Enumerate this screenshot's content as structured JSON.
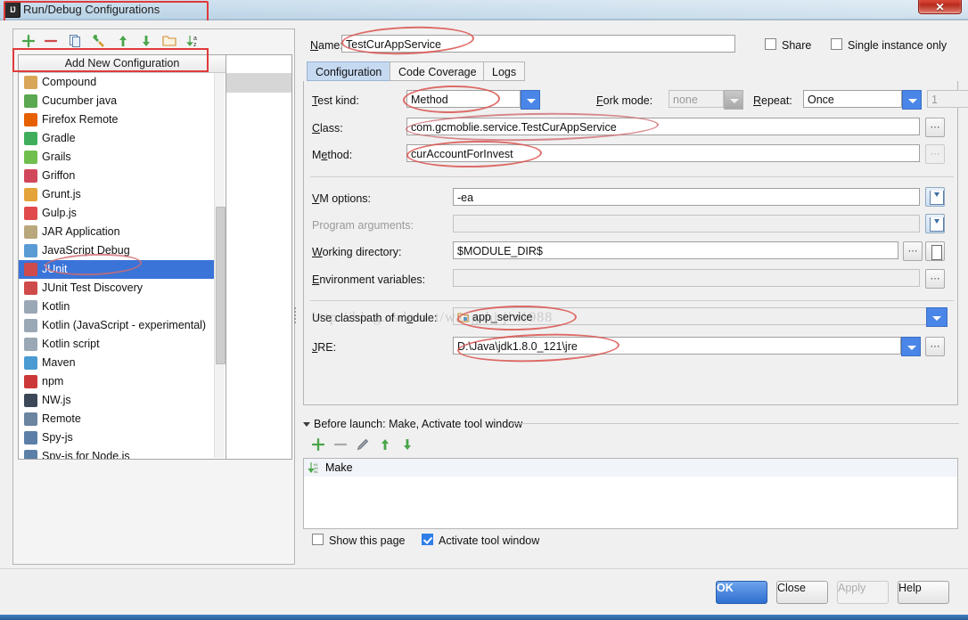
{
  "window": {
    "title": "Run/Debug Configurations",
    "app_icon": "IJ",
    "close_icon": "close-icon",
    "close_glyph": "✕"
  },
  "left_pane": {
    "toolbar": [
      {
        "name": "add-configuration-button",
        "icon": "plus-icon",
        "tooltip": "Add New Configuration"
      },
      {
        "name": "remove-configuration-button",
        "icon": "minus-icon",
        "tooltip": "Remove Configuration"
      },
      {
        "name": "copy-configuration-button",
        "icon": "copy-icon",
        "tooltip": "Copy Configuration"
      },
      {
        "name": "save-configuration-button",
        "icon": "wrench-icon",
        "tooltip": "Save Configuration"
      },
      {
        "name": "move-up-button",
        "icon": "arrow-up-icon",
        "tooltip": "Move Up"
      },
      {
        "name": "move-down-button",
        "icon": "arrow-down-icon",
        "tooltip": "Move Down"
      },
      {
        "name": "create-folder-button",
        "icon": "folder-icon",
        "tooltip": "Create New Folder"
      },
      {
        "name": "sort-configurations-button",
        "icon": "sort-az-icon",
        "tooltip": "Sort Configurations"
      }
    ],
    "list_header": "Add New Configuration",
    "items": [
      {
        "label": "Compound",
        "icon": "compound-icon",
        "color": "#d8a657",
        "selected": false
      },
      {
        "label": "Cucumber java",
        "icon": "cucumber-icon",
        "color": "#5aa84f",
        "selected": false
      },
      {
        "label": "Firefox Remote",
        "icon": "firefox-icon",
        "color": "#e66000",
        "selected": false
      },
      {
        "label": "Gradle",
        "icon": "gradle-icon",
        "color": "#3fae5a",
        "selected": false
      },
      {
        "label": "Grails",
        "icon": "grails-icon",
        "color": "#6fbf4f",
        "selected": false
      },
      {
        "label": "Griffon",
        "icon": "griffon-icon",
        "color": "#d1485c",
        "selected": false
      },
      {
        "label": "Grunt.js",
        "icon": "grunt-icon",
        "color": "#e5a33b",
        "selected": false
      },
      {
        "label": "Gulp.js",
        "icon": "gulp-icon",
        "color": "#e04a4a",
        "selected": false
      },
      {
        "label": "JAR Application",
        "icon": "jar-icon",
        "color": "#b9a77e",
        "selected": false
      },
      {
        "label": "JavaScript Debug",
        "icon": "javascript-debug-icon",
        "color": "#5a9bd5",
        "selected": false
      },
      {
        "label": "JUnit",
        "icon": "junit-icon",
        "color": "#cf4a4a",
        "selected": true
      },
      {
        "label": "JUnit Test Discovery",
        "icon": "junit-discovery-icon",
        "color": "#cf4a4a",
        "selected": false
      },
      {
        "label": "Kotlin",
        "icon": "kotlin-icon",
        "color": "#9aa7b5",
        "selected": false
      },
      {
        "label": "Kotlin (JavaScript - experimental)",
        "icon": "kotlin-js-icon",
        "color": "#9aa7b5",
        "selected": false
      },
      {
        "label": "Kotlin script",
        "icon": "kotlin-script-icon",
        "color": "#9aa7b5",
        "selected": false
      },
      {
        "label": "Maven",
        "icon": "maven-icon",
        "color": "#4a9bd1",
        "selected": false
      },
      {
        "label": "npm",
        "icon": "npm-icon",
        "color": "#cb3837",
        "selected": false
      },
      {
        "label": "NW.js",
        "icon": "nwjs-icon",
        "color": "#3c4858",
        "selected": false
      },
      {
        "label": "Remote",
        "icon": "remote-icon",
        "color": "#6b84a0",
        "selected": false
      },
      {
        "label": "Spy-js",
        "icon": "spyjs-icon",
        "color": "#5b7fa6",
        "selected": false
      },
      {
        "label": "Spy-js for Node.js",
        "icon": "spyjs-node-icon",
        "color": "#5b7fa6",
        "selected": false
      }
    ]
  },
  "form": {
    "name_label": "Name:",
    "name_value": "TestCurAppService",
    "share_label": "Share",
    "share_checked": false,
    "single_instance_label": "Single instance only",
    "single_instance_checked": false,
    "tabs": [
      {
        "label": "Configuration",
        "active": true
      },
      {
        "label": "Code Coverage",
        "active": false
      },
      {
        "label": "Logs",
        "active": false
      }
    ],
    "test_kind_label": "Test kind:",
    "test_kind_value": "Method",
    "fork_mode_label": "Fork mode:",
    "fork_mode_value": "none",
    "repeat_label": "Repeat:",
    "repeat_value": "Once",
    "repeat_count_value": "1",
    "class_label": "Class:",
    "class_value": "com.gcmoblie.service.TestCurAppService",
    "method_label": "Method:",
    "method_value": "curAccountForInvest",
    "vm_options_label": "VM options:",
    "vm_options_value": "-ea",
    "program_arguments_label": "Program arguments:",
    "program_arguments_value": "",
    "working_directory_label": "Working directory:",
    "working_directory_value": "$MODULE_DIR$",
    "environment_variables_label": "Environment variables:",
    "environment_variables_value": "",
    "classpath_module_label": "Use classpath of module:",
    "classpath_module_value": "app_service",
    "jre_label": "JRE:",
    "jre_value": "D:\\Java\\jdk1.8.0_121\\jre",
    "browse_icon": "⋯",
    "expand_icon": "expand-icon",
    "macro_icon": "macro-icon"
  },
  "before_launch": {
    "header": "Before launch: Make, Activate tool window",
    "toolbar": [
      {
        "name": "add-task-button",
        "icon": "plus-icon"
      },
      {
        "name": "remove-task-button",
        "icon": "minus-icon"
      },
      {
        "name": "edit-task-button",
        "icon": "pencil-icon"
      },
      {
        "name": "move-task-up-button",
        "icon": "arrow-up-icon"
      },
      {
        "name": "move-task-down-button",
        "icon": "arrow-down-icon"
      }
    ],
    "tasks": [
      {
        "label": "Make",
        "icon": "make-icon"
      }
    ],
    "show_page_label": "Show this page",
    "show_page_checked": false,
    "activate_tool_window_label": "Activate tool window",
    "activate_tool_window_checked": true
  },
  "buttons": {
    "ok": "OK",
    "close": "Close",
    "apply": "Apply",
    "apply_enabled": false,
    "help": "Help"
  },
  "watermark": "http://blog.csdn.net/wangshi jin1988",
  "colors": {
    "selection_blue": "#3a74d8",
    "accent_blue": "#4a86e8",
    "primary_button": "#2f6fd0",
    "annotation_red": "#d9534f",
    "tab_active": "#c5d9f1"
  }
}
